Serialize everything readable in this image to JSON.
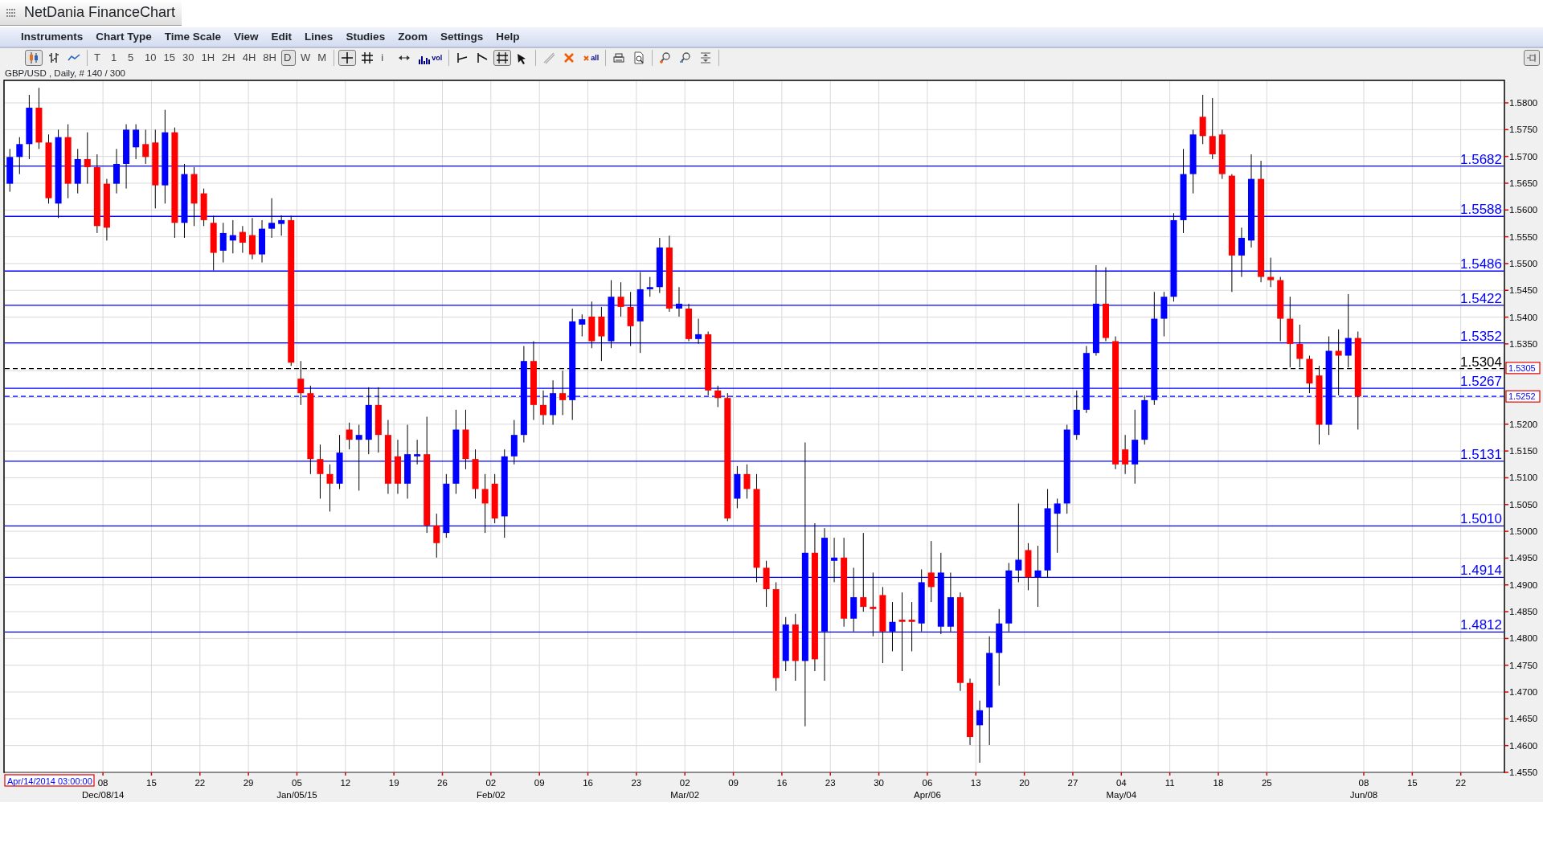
{
  "window": {
    "title": "NetDania FinanceChart"
  },
  "menu": [
    "Instruments",
    "Chart Type",
    "Time Scale",
    "View",
    "Edit",
    "Lines",
    "Studies",
    "Zoom",
    "Settings",
    "Help"
  ],
  "toolbar": [
    {
      "items": [
        {
          "kind": "candles",
          "selected": true
        },
        {
          "kind": "bars",
          "selected": false
        },
        {
          "kind": "line",
          "selected": false
        }
      ]
    },
    {
      "items": [
        {
          "kind": "text",
          "label": "T",
          "selected": false
        },
        {
          "kind": "text",
          "label": "1",
          "selected": false
        },
        {
          "kind": "text",
          "label": "5",
          "selected": false
        },
        {
          "kind": "text",
          "label": "10",
          "selected": false
        },
        {
          "kind": "text",
          "label": "15",
          "selected": false
        },
        {
          "kind": "text",
          "label": "30",
          "selected": false
        },
        {
          "kind": "text",
          "label": "1H",
          "selected": false
        },
        {
          "kind": "text",
          "label": "2H",
          "selected": false
        },
        {
          "kind": "text",
          "label": "4H",
          "selected": false
        },
        {
          "kind": "text",
          "label": "8H",
          "selected": false
        },
        {
          "kind": "text",
          "label": "D",
          "selected": true
        },
        {
          "kind": "text",
          "label": "W",
          "selected": false
        },
        {
          "kind": "text",
          "label": "M",
          "selected": false
        }
      ]
    },
    {
      "items": [
        {
          "kind": "crosshair",
          "selected": true
        },
        {
          "kind": "grid",
          "selected": false
        },
        {
          "kind": "text",
          "label": "i",
          "selected": false
        },
        {
          "kind": "arrows",
          "selected": false
        },
        {
          "kind": "volume",
          "label": "vol",
          "selected": false
        }
      ]
    },
    {
      "items": [
        {
          "kind": "trend",
          "selected": false
        },
        {
          "kind": "trend-fan",
          "selected": false
        },
        {
          "kind": "levels",
          "selected": true
        },
        {
          "kind": "pointer",
          "selected": false
        }
      ]
    },
    {
      "items": [
        {
          "kind": "pen",
          "selected": false
        },
        {
          "kind": "delete",
          "selected": false
        },
        {
          "kind": "delete-all",
          "label": "all",
          "selected": false
        }
      ]
    },
    {
      "items": [
        {
          "kind": "print",
          "selected": false
        },
        {
          "kind": "preview",
          "selected": false
        }
      ]
    },
    {
      "items": [
        {
          "kind": "zoom-in",
          "selected": false
        },
        {
          "kind": "zoom-out",
          "selected": false
        },
        {
          "kind": "fit",
          "selected": false
        }
      ]
    }
  ],
  "info": "GBP/USD , Daily, # 140 / 300",
  "cursor_readout": "Apr/14/2014 03:00:00",
  "axis_tags": [
    "1.5305",
    "1.5252"
  ],
  "chart_data": {
    "type": "candlestick",
    "grid": true,
    "ylim": [
      1.455,
      1.5842
    ],
    "categories": [
      null,
      null,
      null,
      null,
      null,
      null,
      null,
      null,
      null,
      null,
      "08\nDec/08/14",
      null,
      null,
      null,
      null,
      "15",
      null,
      null,
      null,
      null,
      "22",
      null,
      null,
      null,
      null,
      "29",
      null,
      null,
      null,
      null,
      "05\nJan/05/15",
      null,
      null,
      null,
      null,
      "12",
      null,
      null,
      null,
      null,
      "19",
      null,
      null,
      null,
      null,
      "26",
      null,
      null,
      null,
      null,
      "02\nFeb/02",
      null,
      null,
      null,
      null,
      "09",
      null,
      null,
      null,
      null,
      "16",
      null,
      null,
      null,
      null,
      "23",
      null,
      null,
      null,
      null,
      "02\nMar/02",
      null,
      null,
      null,
      null,
      "09",
      null,
      null,
      null,
      null,
      "16",
      null,
      null,
      null,
      null,
      "23",
      null,
      null,
      null,
      null,
      "30",
      null,
      null,
      null,
      null,
      "06\nApr/06",
      null,
      null,
      null,
      null,
      "13",
      null,
      null,
      null,
      null,
      "20",
      null,
      null,
      null,
      null,
      "27",
      null,
      null,
      null,
      null,
      "04\nMay/04",
      null,
      null,
      null,
      null,
      "11",
      null,
      null,
      null,
      null,
      "18",
      null,
      null,
      null,
      null,
      "25",
      null,
      null,
      null,
      null,
      null,
      null,
      null,
      null,
      null,
      "08\nJun/08",
      null,
      null,
      null,
      null,
      "15",
      null,
      null,
      null,
      null,
      "22",
      null,
      null,
      null
    ],
    "ohlc": [
      [
        1.5649,
        1.5714,
        1.5634,
        1.5699
      ],
      [
        1.5699,
        1.5736,
        1.5667,
        1.5723
      ],
      [
        1.5723,
        1.5815,
        1.5695,
        1.5791
      ],
      [
        1.5791,
        1.5828,
        1.5714,
        1.5726
      ],
      [
        1.5726,
        1.5741,
        1.5612,
        1.5622
      ],
      [
        1.5612,
        1.575,
        1.5585,
        1.5736
      ],
      [
        1.5736,
        1.576,
        1.5622,
        1.5649
      ],
      [
        1.5649,
        1.5714,
        1.5631,
        1.5695
      ],
      [
        1.5695,
        1.5745,
        1.5649,
        1.568
      ],
      [
        1.568,
        1.5704,
        1.5557,
        1.557
      ],
      [
        1.5649,
        1.5658,
        1.5543,
        1.5567
      ],
      [
        1.5649,
        1.5714,
        1.5631,
        1.5686
      ],
      [
        1.5686,
        1.576,
        1.564,
        1.575
      ],
      [
        1.5717,
        1.576,
        1.5695,
        1.575
      ],
      [
        1.5723,
        1.575,
        1.5686,
        1.5699
      ],
      [
        1.5726,
        1.575,
        1.5603,
        1.5646
      ],
      [
        1.5646,
        1.5787,
        1.5612,
        1.5745
      ],
      [
        1.5745,
        1.5754,
        1.5548,
        1.5576
      ],
      [
        1.5576,
        1.5686,
        1.5548,
        1.5667
      ],
      [
        1.5667,
        1.568,
        1.557,
        1.5612
      ],
      [
        1.5631,
        1.564,
        1.557,
        1.5581
      ],
      [
        1.5576,
        1.5589,
        1.5487,
        1.552
      ],
      [
        1.5524,
        1.5576,
        1.5502,
        1.5557
      ],
      [
        1.5543,
        1.5581,
        1.5519,
        1.5553
      ],
      [
        1.5559,
        1.557,
        1.552,
        1.5539
      ],
      [
        1.5553,
        1.5585,
        1.5508,
        1.5517
      ],
      [
        1.5517,
        1.5581,
        1.5502,
        1.5565
      ],
      [
        1.5565,
        1.5622,
        1.5548,
        1.5576
      ],
      [
        1.5574,
        1.559,
        1.5552,
        1.5581
      ],
      [
        1.5581,
        1.5589,
        1.5309,
        1.5315
      ],
      [
        1.5285,
        1.5318,
        1.5236,
        1.5258
      ],
      [
        1.5258,
        1.5272,
        1.5107,
        1.5135
      ],
      [
        1.5135,
        1.5162,
        1.5061,
        1.5107
      ],
      [
        1.5107,
        1.5125,
        1.5037,
        1.5089
      ],
      [
        1.5089,
        1.518,
        1.5079,
        1.5147
      ],
      [
        1.519,
        1.5203,
        1.5153,
        1.5171
      ],
      [
        1.5171,
        1.5199,
        1.5076,
        1.518
      ],
      [
        1.5171,
        1.5269,
        1.5144,
        1.5236
      ],
      [
        1.5236,
        1.5269,
        1.5147,
        1.518
      ],
      [
        1.518,
        1.5208,
        1.507,
        1.5089
      ],
      [
        1.514,
        1.5171,
        1.507,
        1.5089
      ],
      [
        1.5089,
        1.5199,
        1.5061,
        1.5144
      ],
      [
        1.514,
        1.5171,
        1.5125,
        1.5144
      ],
      [
        1.5144,
        1.5214,
        1.4997,
        1.5011
      ],
      [
        1.5011,
        1.5033,
        1.4951,
        1.4978
      ],
      [
        1.4997,
        1.5107,
        1.4988,
        1.5089
      ],
      [
        1.5089,
        1.5227,
        1.507,
        1.519
      ],
      [
        1.519,
        1.5227,
        1.5116,
        1.5135
      ],
      [
        1.5135,
        1.5153,
        1.5061,
        1.5079
      ],
      [
        1.5079,
        1.5107,
        1.4997,
        1.5052
      ],
      [
        1.5089,
        1.5107,
        1.5015,
        1.5024
      ],
      [
        1.5028,
        1.5153,
        1.4988,
        1.514
      ],
      [
        1.514,
        1.5208,
        1.5125,
        1.518
      ],
      [
        1.518,
        1.5346,
        1.5166,
        1.5318
      ],
      [
        1.5318,
        1.5355,
        1.5208,
        1.5236
      ],
      [
        1.5236,
        1.5263,
        1.5199,
        1.5217
      ],
      [
        1.5217,
        1.5282,
        1.5199,
        1.5258
      ],
      [
        1.5258,
        1.53,
        1.5217,
        1.5245
      ],
      [
        1.5245,
        1.5416,
        1.5208,
        1.5392
      ],
      [
        1.5386,
        1.5405,
        1.5364,
        1.5396
      ],
      [
        1.5401,
        1.5429,
        1.5342,
        1.5355
      ],
      [
        1.5401,
        1.5419,
        1.5318,
        1.5364
      ],
      [
        1.5355,
        1.5469,
        1.5342,
        1.5438
      ],
      [
        1.5438,
        1.5465,
        1.5401,
        1.5419
      ],
      [
        1.5419,
        1.5447,
        1.5346,
        1.5383
      ],
      [
        1.5392,
        1.5484,
        1.5333,
        1.5452
      ],
      [
        1.5452,
        1.5475,
        1.5438,
        1.5456
      ],
      [
        1.5456,
        1.5548,
        1.5445,
        1.553
      ],
      [
        1.553,
        1.5552,
        1.541,
        1.5416
      ],
      [
        1.5416,
        1.5456,
        1.5401,
        1.5425
      ],
      [
        1.5416,
        1.5425,
        1.5355,
        1.5359
      ],
      [
        1.5359,
        1.5397,
        1.535,
        1.5368
      ],
      [
        1.5368,
        1.5373,
        1.5254,
        1.5263
      ],
      [
        1.5263,
        1.5272,
        1.5232,
        1.5249
      ],
      [
        1.5249,
        1.5258,
        1.5019,
        1.5024
      ],
      [
        1.5061,
        1.5122,
        1.5043,
        1.5107
      ],
      [
        1.5107,
        1.5125,
        1.5061,
        1.5079
      ],
      [
        1.5079,
        1.5107,
        1.4905,
        1.4932
      ],
      [
        1.4932,
        1.4945,
        1.4859,
        1.4892
      ],
      [
        1.4892,
        1.4905,
        1.4702,
        1.4726
      ],
      [
        1.4758,
        1.484,
        1.4739,
        1.4826
      ],
      [
        1.4826,
        1.4846,
        1.4721,
        1.4758
      ],
      [
        1.4758,
        1.5166,
        1.4636,
        1.496
      ],
      [
        1.496,
        1.5015,
        1.4739,
        1.4761
      ],
      [
        1.4813,
        1.5006,
        1.4721,
        1.4988
      ],
      [
        1.4945,
        1.4988,
        1.4905,
        1.4951
      ],
      [
        1.4951,
        1.4988,
        1.4822,
        1.4837
      ],
      [
        1.4837,
        1.4932,
        1.4813,
        1.4877
      ],
      [
        1.4877,
        1.4997,
        1.485,
        1.4859
      ],
      [
        1.4859,
        1.4923,
        1.4804,
        1.4855
      ],
      [
        1.4881,
        1.4896,
        1.4754,
        1.4813
      ],
      [
        1.4813,
        1.4868,
        1.4776,
        1.4831
      ],
      [
        1.4835,
        1.4886,
        1.4739,
        1.4831
      ],
      [
        1.4835,
        1.4868,
        1.4776,
        1.4831
      ],
      [
        1.4828,
        1.4929,
        1.4813,
        1.4905
      ],
      [
        1.4923,
        1.4982,
        1.4868,
        1.4896
      ],
      [
        1.4822,
        1.496,
        1.4808,
        1.4923
      ],
      [
        1.4822,
        1.4923,
        1.4813,
        1.4877
      ],
      [
        1.4877,
        1.4886,
        1.4702,
        1.4717
      ],
      [
        1.4717,
        1.4725,
        1.4601,
        1.4616
      ],
      [
        1.4638,
        1.4684,
        1.4568,
        1.4666
      ],
      [
        1.4671,
        1.4804,
        1.4601,
        1.4773
      ],
      [
        1.4773,
        1.4855,
        1.4712,
        1.4828
      ],
      [
        1.4828,
        1.4941,
        1.4813,
        1.4927
      ],
      [
        1.4927,
        1.5052,
        1.4905,
        1.4947
      ],
      [
        1.4965,
        1.4978,
        1.489,
        1.4914
      ],
      [
        1.4914,
        1.4973,
        1.4859,
        1.4927
      ],
      [
        1.4927,
        1.5079,
        1.4914,
        1.5043
      ],
      [
        1.5033,
        1.5061,
        1.496,
        1.5052
      ],
      [
        1.5052,
        1.5199,
        1.5033,
        1.519
      ],
      [
        1.518,
        1.5263,
        1.5171,
        1.5227
      ],
      [
        1.5227,
        1.5346,
        1.5221,
        1.5333
      ],
      [
        1.5333,
        1.5497,
        1.5328,
        1.5425
      ],
      [
        1.5425,
        1.5493,
        1.5355,
        1.5361
      ],
      [
        1.5355,
        1.5364,
        1.5116,
        1.5125
      ],
      [
        1.5153,
        1.518,
        1.5107,
        1.5125
      ],
      [
        1.5125,
        1.5227,
        1.5089,
        1.5171
      ],
      [
        1.5171,
        1.5254,
        1.5162,
        1.5245
      ],
      [
        1.5245,
        1.5447,
        1.5236,
        1.5397
      ],
      [
        1.5397,
        1.5447,
        1.5364,
        1.5438
      ],
      [
        1.5438,
        1.5594,
        1.5429,
        1.5581
      ],
      [
        1.5581,
        1.5714,
        1.5557,
        1.5667
      ],
      [
        1.5667,
        1.575,
        1.5631,
        1.5741
      ],
      [
        1.5774,
        1.5815,
        1.5723,
        1.5738
      ],
      [
        1.5738,
        1.5809,
        1.5695,
        1.5704
      ],
      [
        1.5741,
        1.575,
        1.5658,
        1.5667
      ],
      [
        1.5664,
        1.5667,
        1.5447,
        1.5515
      ],
      [
        1.5515,
        1.5567,
        1.5475,
        1.5548
      ],
      [
        1.5543,
        1.5704,
        1.553,
        1.5658
      ],
      [
        1.5658,
        1.5692,
        1.5465,
        1.5475
      ],
      [
        1.5475,
        1.5511,
        1.5456,
        1.5469
      ],
      [
        1.5469,
        1.5475,
        1.5355,
        1.5397
      ],
      [
        1.5397,
        1.5438,
        1.5306,
        1.535
      ],
      [
        1.535,
        1.5386,
        1.5306,
        1.5322
      ],
      [
        1.5322,
        1.5328,
        1.5258,
        1.5276
      ],
      [
        1.5291,
        1.5309,
        1.5162,
        1.5199
      ],
      [
        1.5199,
        1.5364,
        1.518,
        1.5337
      ],
      [
        1.5337,
        1.5377,
        1.5254,
        1.5328
      ],
      [
        1.5328,
        1.5443,
        1.5306,
        1.5361
      ],
      [
        1.5361,
        1.5373,
        1.519,
        1.5252
      ],
      null,
      null,
      null,
      null,
      null,
      null,
      null,
      null,
      null,
      null,
      null,
      null,
      null,
      null
    ],
    "yticks": [
      {
        "value": 1.455,
        "label": "1.4550"
      },
      {
        "value": 1.46,
        "label": "1.4600"
      },
      {
        "value": 1.465,
        "label": "1.4650"
      },
      {
        "value": 1.47,
        "label": "1.4700"
      },
      {
        "value": 1.475,
        "label": "1.4750"
      },
      {
        "value": 1.48,
        "label": "1.4800"
      },
      {
        "value": 1.485,
        "label": "1.4850"
      },
      {
        "value": 1.49,
        "label": "1.4900"
      },
      {
        "value": 1.495,
        "label": "1.4950"
      },
      {
        "value": 1.5,
        "label": "1.5000"
      },
      {
        "value": 1.505,
        "label": "1.5050"
      },
      {
        "value": 1.51,
        "label": "1.5100"
      },
      {
        "value": 1.515,
        "label": "1.5150"
      },
      {
        "value": 1.52,
        "label": "1.5200"
      },
      {
        "value": 1.535,
        "label": "1.5350"
      },
      {
        "value": 1.54,
        "label": "1.5400"
      },
      {
        "value": 1.545,
        "label": "1.5450"
      },
      {
        "value": 1.55,
        "label": "1.5500"
      },
      {
        "value": 1.555,
        "label": "1.5550"
      },
      {
        "value": 1.56,
        "label": "1.5600"
      },
      {
        "value": 1.565,
        "label": "1.5650"
      },
      {
        "value": 1.57,
        "label": "1.5700"
      },
      {
        "value": 1.575,
        "label": "1.5750"
      },
      {
        "value": 1.58,
        "label": "1.5800"
      }
    ],
    "ref_lines": [
      {
        "axis": "y",
        "value": 1.5682,
        "label": "1.5682",
        "color": "#0000ff"
      },
      {
        "axis": "y",
        "value": 1.5588,
        "label": "1.5588",
        "color": "#0000ff"
      },
      {
        "axis": "y",
        "value": 1.5486,
        "label": "1.5486",
        "color": "#0000ff"
      },
      {
        "axis": "y",
        "value": 1.5422,
        "label": "1.5422",
        "color": "#0000ff"
      },
      {
        "axis": "y",
        "value": 1.5352,
        "label": "1.5352",
        "color": "#0000ff"
      },
      {
        "axis": "y",
        "value": 1.5304,
        "label": "1.5304",
        "color": "#000000"
      },
      {
        "axis": "y",
        "value": 1.5267,
        "label": "1.5267",
        "color": "#0000ff"
      },
      {
        "axis": "y",
        "value": 1.5252,
        "color": "#0000ff"
      },
      {
        "axis": "y",
        "value": 1.5131,
        "label": "1.5131",
        "color": "#0000ff"
      },
      {
        "axis": "y",
        "value": 1.501,
        "label": "1.5010",
        "color": "#0000ff"
      },
      {
        "axis": "y",
        "value": 1.4914,
        "label": "1.4914",
        "color": "#0000ff"
      },
      {
        "axis": "y",
        "value": 1.4812,
        "label": "1.4812",
        "color": "#0000ff"
      }
    ]
  }
}
